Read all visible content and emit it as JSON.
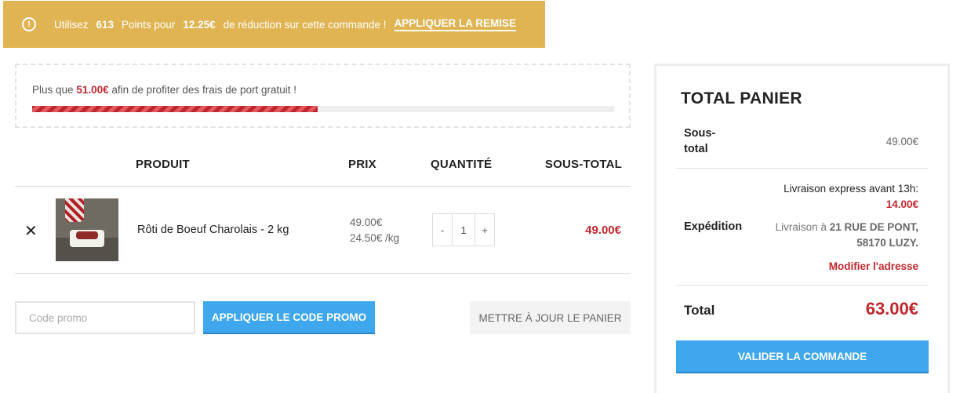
{
  "notice": {
    "icon": "info-icon",
    "use_label": "Utilisez",
    "points": "613",
    "points_label": "Points pour",
    "discount": "12.25€",
    "discount_label": "de réduction sur cette commande !",
    "apply_label": "APPLIQUER LA REMISE",
    "color": "#e0b453"
  },
  "free_shipping": {
    "prefix": "Plus que",
    "amount": "51.00€",
    "suffix": "afin de profiter des frais de port gratuit !",
    "progress_fraction": 0.49,
    "bar_color": "#c0272d"
  },
  "table": {
    "headers": {
      "product": "PRODUIT",
      "price": "PRIX",
      "quantity": "QUANTITÉ",
      "subtotal": "SOUS-TOTAL"
    },
    "rows": [
      {
        "remove_icon": "close-icon",
        "name": "Rôti de Boeuf Charolais - 2 kg",
        "price": "49.00€",
        "unit_price": "24.50€ /kg",
        "qty_minus": "-",
        "quantity": "1",
        "qty_plus": "+",
        "subtotal": "49.00€"
      }
    ]
  },
  "coupon": {
    "placeholder": "Code promo",
    "apply_label": "APPLIQUER LE CODE PROMO",
    "update_label": "METTRE À JOUR LE PANIER"
  },
  "totals": {
    "title": "TOTAL PANIER",
    "subtotal_label": "Sous-total",
    "subtotal_value": "49.00€",
    "shipping_label": "Expédition",
    "shipping_method": "Livraison express avant 13h:",
    "shipping_price": "14.00€",
    "shipping_dest_prefix": "Livraison à",
    "shipping_dest_line1": "21 RUE DE PONT,",
    "shipping_dest_line2": "58170 LUZY.",
    "edit_address": "Modifier l'adresse",
    "total_label": "Total",
    "total_value": "63.00€",
    "checkout_label": "VALIDER LA COMMANDE",
    "accent": "#c0272d",
    "button_color": "#3ea7ee"
  }
}
